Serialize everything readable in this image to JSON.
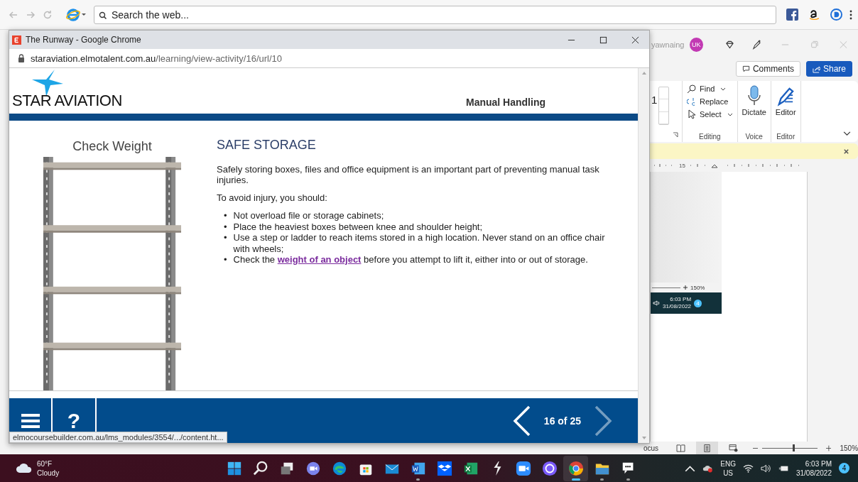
{
  "browser_bar": {
    "search_placeholder": "Search the web..."
  },
  "word": {
    "user": "yawnaing",
    "avatar": "UK",
    "comments": "Comments",
    "share": "Share",
    "font_size": "1",
    "groups": [
      {
        "kind": "list",
        "label": "Editing",
        "items": [
          {
            "kind": "find",
            "label": "Find",
            "dropdown": true
          },
          {
            "kind": "replace",
            "label": "Replace",
            "dropdown": false
          },
          {
            "kind": "select",
            "label": "Select",
            "dropdown": true
          }
        ]
      },
      {
        "kind": "dictate",
        "label": "Voice",
        "button": "Dictate"
      },
      {
        "kind": "editor",
        "label": "Editor",
        "button": "Editor"
      }
    ],
    "ruler_mark": "15",
    "embedded_screenshot": {
      "zoom": "150%",
      "time": "6:03 PM",
      "date": "31/08/2022",
      "badge": "4"
    },
    "status_bar": {
      "focus": "ocus",
      "zoom_slider": {
        "level": 0.55
      },
      "zoom": "150%",
      "views": [
        {
          "kind": "read",
          "selected": false
        },
        {
          "kind": "print",
          "selected": true
        },
        {
          "kind": "web",
          "selected": false
        }
      ]
    }
  },
  "popup": {
    "title": "The Runway - Google Chrome",
    "url_host": "staraviation.elmotalent.com.au",
    "url_path": "/learning/view-activity/16/url/10",
    "status_link": "elmocoursebuilder.com.au/lms_modules/3554/.../content.ht...",
    "page": {
      "logo": "STAR AVIATION",
      "module": "Manual Handling",
      "image_caption": "Check Weight",
      "heading": "SAFE STORAGE",
      "intro": "Safely storing boxes, files and office equipment is an important part of preventing manual task injuries.",
      "lead": "To avoid injury, you should:",
      "bullet": "•",
      "bullets": [
        {
          "kind": "text",
          "text": "Not overload file or storage cabinets;"
        },
        {
          "kind": "text",
          "text": "Place the heaviest boxes between knee and shoulder height;"
        },
        {
          "kind": "text",
          "text": "Use a step or ladder to reach items stored in a high location. Never stand on an office chair with wheels;"
        },
        {
          "kind": "link",
          "before": "Check the ",
          "link": "weight of an object",
          "after": " before you attempt to lift it, either into or out of storage."
        }
      ],
      "footer": {
        "help": "?",
        "progress": "16 of 25",
        "prev_disabled": false,
        "next_disabled": true
      }
    }
  },
  "taskbar": {
    "temperature": "60°F",
    "weather": "Cloudy",
    "apps": [
      {
        "kind": "start",
        "selected": false,
        "open": false
      },
      {
        "kind": "search",
        "selected": false,
        "open": false
      },
      {
        "kind": "taskview",
        "selected": false,
        "open": false
      },
      {
        "kind": "chat",
        "selected": false,
        "open": false
      },
      {
        "kind": "edge",
        "selected": false,
        "open": false
      },
      {
        "kind": "store",
        "selected": false,
        "open": false
      },
      {
        "kind": "mail",
        "selected": false,
        "open": false
      },
      {
        "kind": "word",
        "selected": false,
        "open": true
      },
      {
        "kind": "dropbox",
        "selected": false,
        "open": false
      },
      {
        "kind": "excel",
        "selected": false,
        "open": false
      },
      {
        "kind": "bolt",
        "selected": false,
        "open": false
      },
      {
        "kind": "zoom",
        "selected": false,
        "open": false
      },
      {
        "kind": "circle",
        "selected": false,
        "open": false
      },
      {
        "kind": "chrome",
        "selected": true,
        "open": true
      },
      {
        "kind": "folder",
        "selected": false,
        "open": true
      },
      {
        "kind": "snip",
        "selected": false,
        "open": true
      }
    ],
    "language": "ENG",
    "region": "US",
    "time": "6:03 PM",
    "date": "31/08/2022",
    "notifications": "4"
  }
}
